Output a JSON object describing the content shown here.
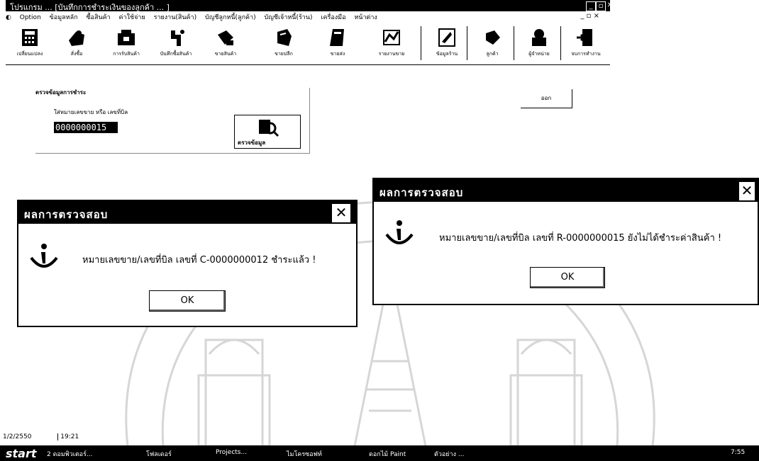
{
  "window": {
    "title": "โปรแกรม ... [บันทึกการชำระเงินของลูกค้า ... ]",
    "controls": [
      "_",
      "▫",
      "✕"
    ]
  },
  "menu": {
    "items": [
      "Option",
      "ข้อมูลหลัก",
      "ซื้อสินค้า",
      "ค่าใช้จ่าย",
      "รายงาน(สินค้า)",
      "บัญชีลูกหนี้(ลูกค้า)",
      "บัญชีเจ้าหนี้(ร้าน)",
      "เครื่องมือ",
      "หน้าต่าง"
    ],
    "right": "_ ▫ ×"
  },
  "toolbar": {
    "items": [
      {
        "label": "เปลี่ยนแปลง",
        "icon": "calculator-icon"
      },
      {
        "label": "สั่งซื้อ",
        "icon": "order-icon"
      },
      {
        "label": "การรับสินค้า",
        "icon": "receive-icon"
      },
      {
        "label": "บันทึกซื้อสินค้า",
        "icon": "purchase-icon"
      },
      {
        "label": "ขายสินค้า",
        "icon": "sale-icon"
      },
      {
        "label": "ขายปลีก",
        "icon": "retail-icon"
      },
      {
        "label": "ขายส่ง",
        "icon": "wholesale-icon"
      },
      {
        "label": "รายงานขาย",
        "icon": "report-icon"
      },
      {
        "label": "ข้อมูลร้าน",
        "icon": "store-icon"
      },
      {
        "label": "ลูกค้า",
        "icon": "customer-icon"
      },
      {
        "label": "ผู้จำหน่าย",
        "icon": "supplier-icon"
      },
      {
        "label": "จบการทำงาน",
        "icon": "exit-icon"
      }
    ]
  },
  "panel": {
    "title": "ตรวจข้อมูลการชำระ",
    "input_label": "ใส่หมายเลขขาย หรือ เลขที่บิล",
    "input_value": "0000000015",
    "check_button_label": "ตรวจข้อมูล",
    "exit_button_label": "ออก"
  },
  "dialog_left": {
    "title": "ผลการตรวจสอบ",
    "message": "หมายเลขขาย/เลขที่บิล เลขที่ C-0000000012 ชำระแล้ว !",
    "ok_label": "OK"
  },
  "dialog_right": {
    "title": "ผลการตรวจสอบ",
    "message": "หมายเลขขาย/เลขที่บิล เลขที่ R-0000000015 ยังไม่ได้ชำระค่าสินค้า !",
    "ok_label": "OK"
  },
  "statusbar": {
    "date": "1/2/2550",
    "time": "19:21"
  },
  "taskbar": {
    "start_label": "start",
    "items": [
      "2 ดอมพิวเตอร์...",
      "โฟลเดอร์",
      "Projects...",
      "ไมโครซอฟท์",
      "ดอกไม้ Paint",
      "ตัวอย่าง ..."
    ],
    "clock": "7:55"
  },
  "colors": {
    "titlebar": "#000000",
    "background": "#ffffff",
    "watermark": "#d8d8d8"
  }
}
